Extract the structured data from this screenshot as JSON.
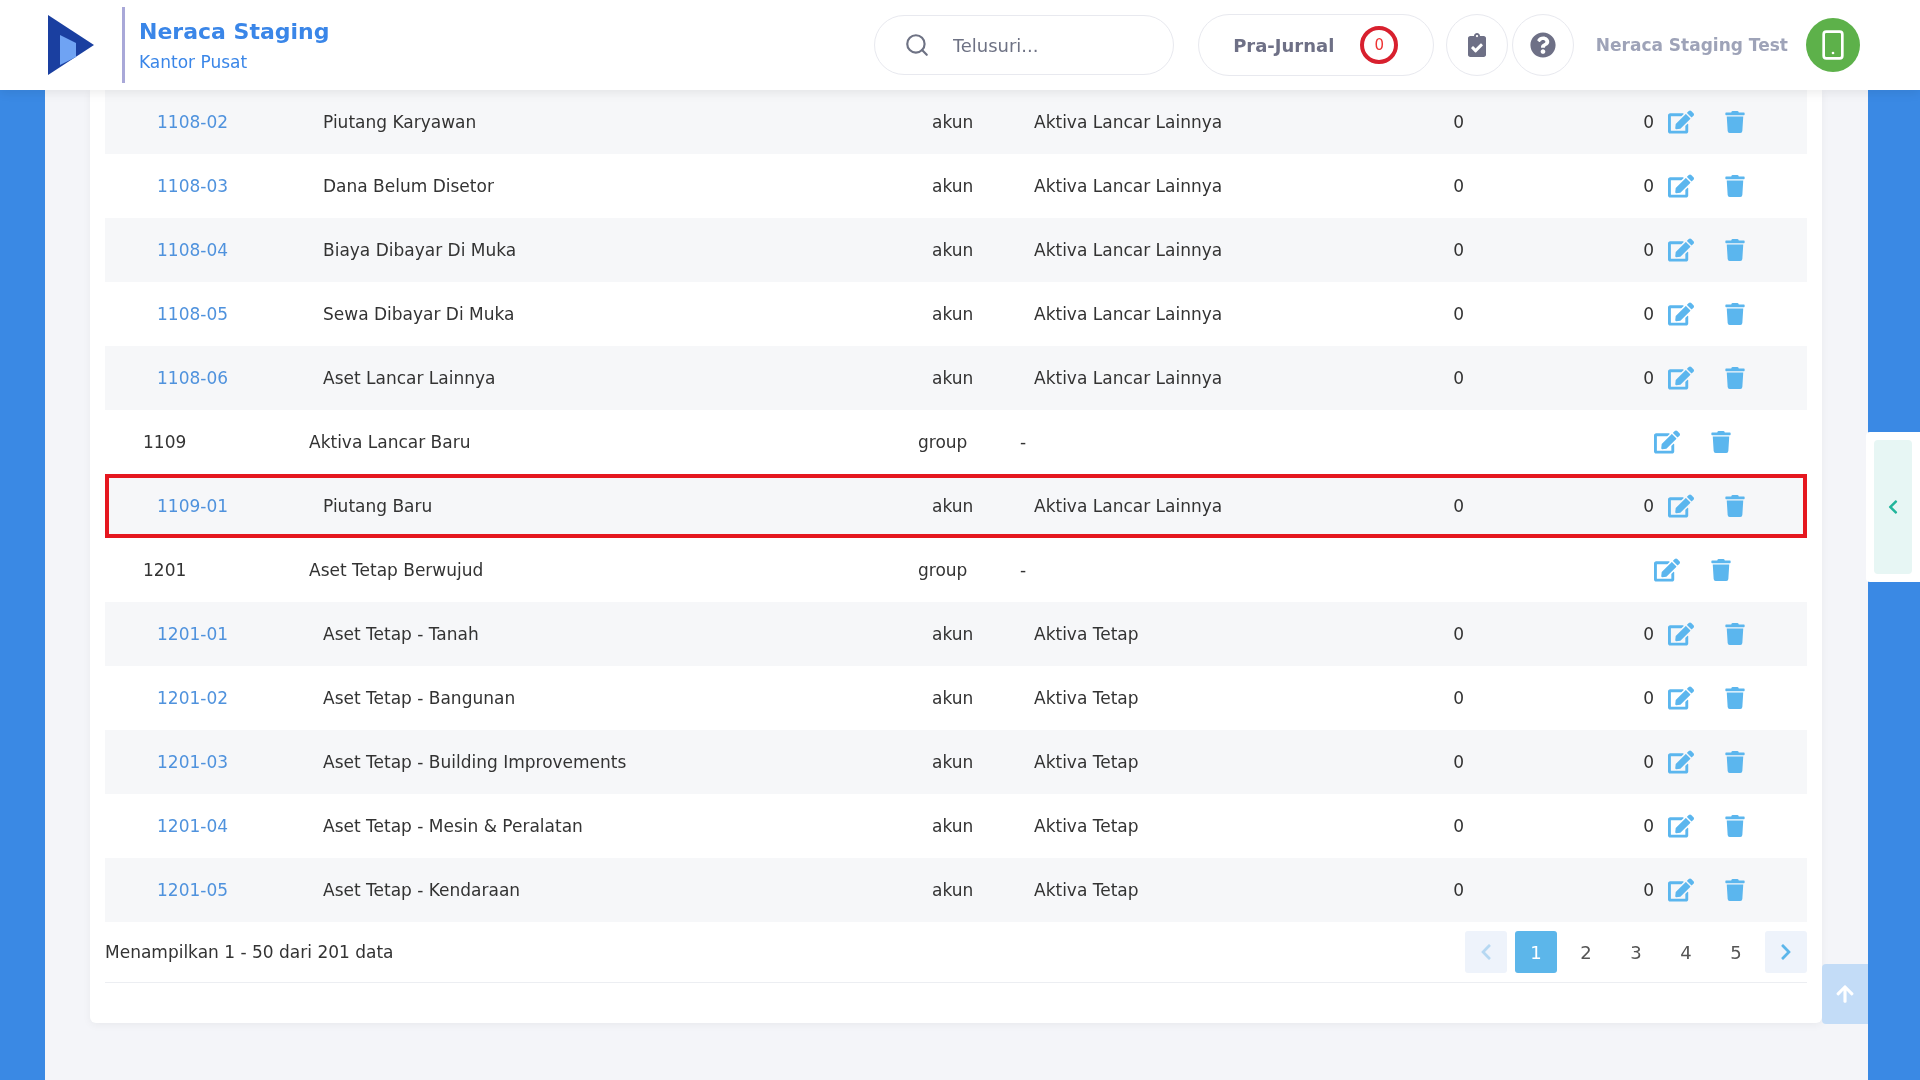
{
  "header": {
    "app_title": "Neraca Staging",
    "branch": "Kantor Pusat",
    "search": {
      "placeholder": "Telusuri..."
    },
    "pre_journal": {
      "label": "Pra-Jurnal",
      "count": "0"
    },
    "user_name": "Neraca Staging Test"
  },
  "table": {
    "rows": [
      {
        "kind": "akun",
        "code": "1108-02",
        "name": "Piutang Karyawan",
        "type": "akun",
        "category": "Aktiva Lancar Lainnya",
        "debit": "0",
        "credit": "0",
        "highlighted": false
      },
      {
        "kind": "akun",
        "code": "1108-03",
        "name": "Dana Belum Disetor",
        "type": "akun",
        "category": "Aktiva Lancar Lainnya",
        "debit": "0",
        "credit": "0",
        "highlighted": false
      },
      {
        "kind": "akun",
        "code": "1108-04",
        "name": "Biaya Dibayar Di Muka",
        "type": "akun",
        "category": "Aktiva Lancar Lainnya",
        "debit": "0",
        "credit": "0",
        "highlighted": false
      },
      {
        "kind": "akun",
        "code": "1108-05",
        "name": "Sewa Dibayar Di Muka",
        "type": "akun",
        "category": "Aktiva Lancar Lainnya",
        "debit": "0",
        "credit": "0",
        "highlighted": false
      },
      {
        "kind": "akun",
        "code": "1108-06",
        "name": "Aset Lancar Lainnya",
        "type": "akun",
        "category": "Aktiva Lancar Lainnya",
        "debit": "0",
        "credit": "0",
        "highlighted": false
      },
      {
        "kind": "group",
        "code": "1109",
        "name": "Aktiva Lancar Baru",
        "type": "group",
        "category": "-",
        "highlighted": false
      },
      {
        "kind": "akun",
        "code": "1109-01",
        "name": "Piutang Baru",
        "type": "akun",
        "category": "Aktiva Lancar Lainnya",
        "debit": "0",
        "credit": "0",
        "highlighted": true
      },
      {
        "kind": "group",
        "code": "1201",
        "name": "Aset Tetap Berwujud",
        "type": "group",
        "category": "-",
        "highlighted": false
      },
      {
        "kind": "akun",
        "code": "1201-01",
        "name": "Aset Tetap - Tanah",
        "type": "akun",
        "category": "Aktiva Tetap",
        "debit": "0",
        "credit": "0",
        "highlighted": false
      },
      {
        "kind": "akun",
        "code": "1201-02",
        "name": "Aset Tetap - Bangunan",
        "type": "akun",
        "category": "Aktiva Tetap",
        "debit": "0",
        "credit": "0",
        "highlighted": false
      },
      {
        "kind": "akun",
        "code": "1201-03",
        "name": "Aset Tetap - Building Improvements",
        "type": "akun",
        "category": "Aktiva Tetap",
        "debit": "0",
        "credit": "0",
        "highlighted": false
      },
      {
        "kind": "akun",
        "code": "1201-04",
        "name": "Aset Tetap - Mesin & Peralatan",
        "type": "akun",
        "category": "Aktiva Tetap",
        "debit": "0",
        "credit": "0",
        "highlighted": false
      },
      {
        "kind": "akun",
        "code": "1201-05",
        "name": "Aset Tetap - Kendaraan",
        "type": "akun",
        "category": "Aktiva Tetap",
        "debit": "0",
        "credit": "0",
        "highlighted": false
      }
    ]
  },
  "footer": {
    "summary": "Menampilkan 1 - 50 dari 201 data",
    "pages": [
      {
        "label": "1",
        "selected": true
      },
      {
        "label": "2",
        "selected": false
      },
      {
        "label": "3",
        "selected": false
      },
      {
        "label": "4",
        "selected": false
      },
      {
        "label": "5",
        "selected": false
      }
    ],
    "prev_disabled": true,
    "next_disabled": false
  }
}
